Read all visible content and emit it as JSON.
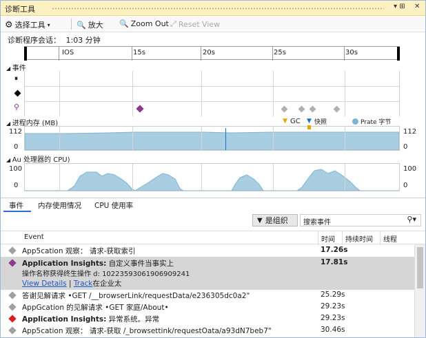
{
  "window": {
    "title": "诊断工具",
    "pin": "▾ ⊞",
    "close": "✕"
  },
  "toolbar": {
    "select_tool": "选择工具",
    "zoom_in": "放大",
    "zoom_out": "Zoom Out",
    "reset_view": "Reset View"
  },
  "session": {
    "label": "诊断程序会话：",
    "value": "1:03 分钟"
  },
  "ruler": {
    "labels": [
      "IOS",
      "15s",
      "20s",
      "25s",
      "30s"
    ]
  },
  "events_section": {
    "title": "事件"
  },
  "memory": {
    "title": "进程内存 (MB)",
    "legend_gc": "GC",
    "legend_snapshot": "快照",
    "legend_private": "Prate 字节",
    "max": "112",
    "min": "0"
  },
  "cpu": {
    "title": "Au 处理器的 CPU)",
    "max": "100",
    "min": "0"
  },
  "tabs": [
    "事件",
    "内存使用情况",
    "CPU 使用率"
  ],
  "filter": {
    "button": "是组织",
    "search_placeholder": "搜索事件"
  },
  "columns": {
    "event": "Event",
    "time": "时间",
    "duration": "持续时间",
    "thread": "线程"
  },
  "events": [
    {
      "prefix": "App5cation 观察：",
      "text": "请求-获取索引",
      "time": "17.26s",
      "color": "#a0a0a0"
    },
    {
      "prefix": "Application Insights:",
      "text": "自定义事件当事实上",
      "time": "17.81s",
      "color": "#8b3b8b",
      "detail": "操作名称获得终生操作 d: 10223593061906909241",
      "link1": "View Details",
      "link_sep": "|",
      "link2": "Track",
      "link_tail": "在企业太"
    },
    {
      "prefix": "",
      "text": "答谢见解请求 •GET                 /__browserLink/requestData/e236305dc0a2\"",
      "time": "25.29s",
      "color": "#a0a0a0"
    },
    {
      "prefix": "",
      "text": "AppGcation 的见解请求 •GET 家庭/About•",
      "time": "29.23s",
      "color": "#a0a0a0"
    },
    {
      "prefix": "Application Insights:",
      "text": "异常系统。异常",
      "time": "29.23s",
      "color": "#d62020"
    },
    {
      "prefix": "",
      "text": "App5cation 观察： 请求-获取 /_browsettink/requestOata/a93dN7beb7\"",
      "time": "30.46s",
      "color": "#a0a0a0"
    }
  ]
}
